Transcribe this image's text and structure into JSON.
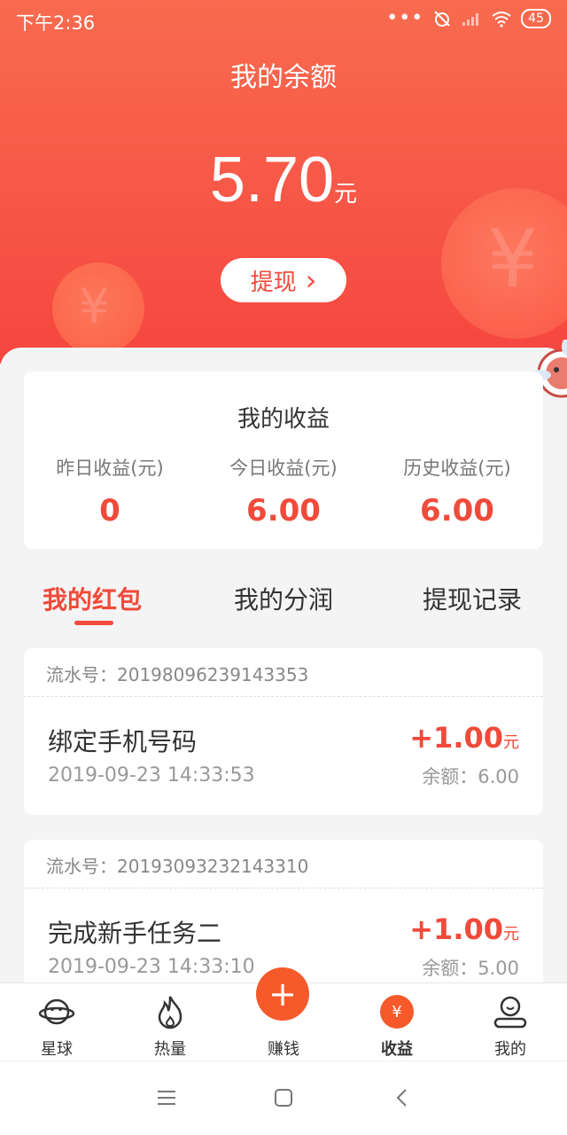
{
  "status_bar": {
    "time": "下午2:36",
    "battery": "45",
    "dots": "•••"
  },
  "header": {
    "title": "我的余额",
    "balance": "5.70",
    "unit": "元",
    "withdraw_label": "提现",
    "withdraw_arrow": "›"
  },
  "earnings": {
    "title": "我的收益",
    "items": [
      {
        "label": "昨日收益(元)",
        "value": "0"
      },
      {
        "label": "今日收益(元)",
        "value": "6.00"
      },
      {
        "label": "历史收益(元)",
        "value": "6.00"
      }
    ]
  },
  "tabs": [
    {
      "label": "我的红包"
    },
    {
      "label": "我的分润"
    },
    {
      "label": "提现记录"
    }
  ],
  "records": [
    {
      "serial": "流水号：20198096239143353",
      "title": "绑定手机号码",
      "time": "2019-09-23 14:33:53",
      "amount": "+1.00",
      "unit": "元",
      "balance": "余额：6.00"
    },
    {
      "serial": "流水号：20193093232143310",
      "title": "完成新手任务二",
      "time": "2019-09-23 14:33:10",
      "amount": "+1.00",
      "unit": "元",
      "balance": "余额：5.00"
    }
  ],
  "bottom_nav": [
    {
      "label": "星球",
      "icon": "planet-icon"
    },
    {
      "label": "热量",
      "icon": "flame-icon"
    },
    {
      "label": "赚钱",
      "icon": "plus-icon",
      "symbol": "+"
    },
    {
      "label": "收益",
      "icon": "yen-coin-icon",
      "symbol": "¥"
    },
    {
      "label": "我的",
      "icon": "profile-icon"
    }
  ],
  "colors": {
    "accent": "#f04a3b",
    "header_top": "#f86b4f",
    "header_bottom": "#f5463f",
    "nav_orange": "#f65a2b"
  }
}
